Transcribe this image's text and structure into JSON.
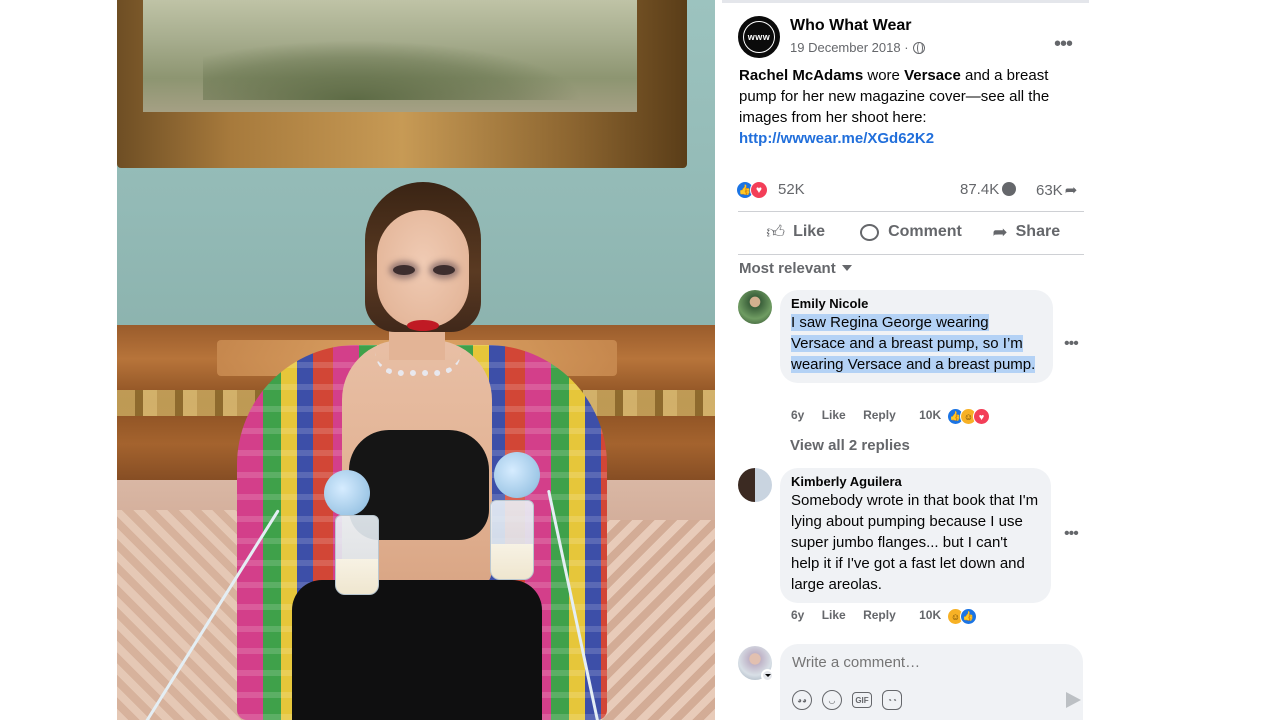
{
  "post": {
    "page_name": "Who What Wear",
    "avatar_text": "www",
    "date": "19 December 2018",
    "more_icon": "more-horizontal-icon",
    "text": {
      "name1": "Rachel McAdams",
      "mid1": " wore ",
      "name2": "Versace",
      "rest": " and a breast pump for her new magazine cover—see all the images from her shoot here: ",
      "link": "http://wwwear.me/XGd62K2"
    },
    "stats": {
      "reactions": "52K",
      "comments": "87.4K",
      "shares": "63K"
    },
    "actions": {
      "like": "Like",
      "comment": "Comment",
      "share": "Share"
    },
    "sort_label": "Most relevant",
    "colors": {
      "link": "#216fdb",
      "like_blue": "#1b74e4",
      "love_red": "#f33e58",
      "selection": "#b4d2f5"
    }
  },
  "comments": [
    {
      "name": "Emily Nicole",
      "text": "I saw Regina George wearing Versace and a breast pump, so I’m wearing Versace and a breast pump.",
      "age": "6y",
      "like": "Like",
      "reply": "Reply",
      "reaction_count": "10K"
    },
    {
      "name": "Kimberly Aguilera",
      "text": "Somebody wrote in that book that I'm lying about pumping because I use super jumbo flanges... but I can't help it if I've got a fast let down and large areolas.",
      "age": "6y",
      "like": "Like",
      "reply": "Reply",
      "reaction_count": "10K"
    }
  ],
  "view_replies": "View all 2 replies",
  "composer": {
    "placeholder": "Write a comment…",
    "tools": [
      "avatar-sticker-icon",
      "emoji-icon",
      "gif-icon",
      "sticker-icon"
    ],
    "gif_label": "GIF"
  }
}
